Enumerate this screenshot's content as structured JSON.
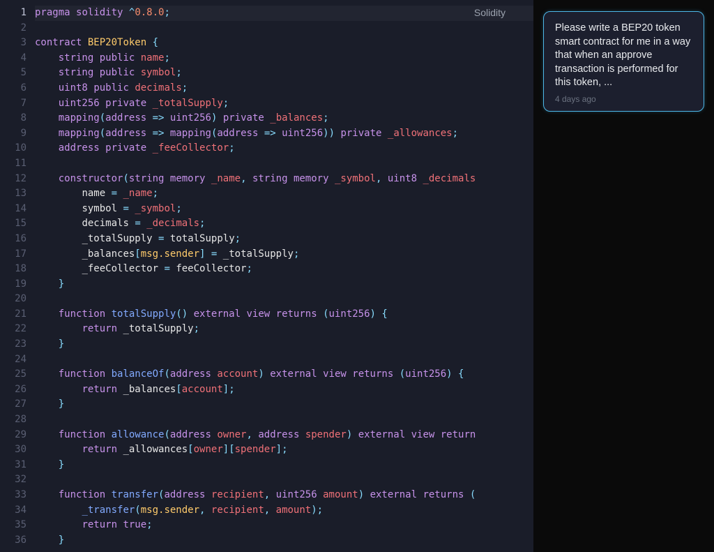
{
  "editor": {
    "language": "Solidity",
    "lineCount": 36,
    "currentLine": 1,
    "lines": [
      [
        [
          "kw",
          "pragma"
        ],
        [
          "plain",
          " "
        ],
        [
          "kw",
          "solidity"
        ],
        [
          "plain",
          " "
        ],
        [
          "op",
          "^"
        ],
        [
          "num",
          "0.8.0"
        ],
        [
          "punc",
          ";"
        ]
      ],
      [],
      [
        [
          "kw",
          "contract"
        ],
        [
          "plain",
          " "
        ],
        [
          "name",
          "BEP20Token"
        ],
        [
          "plain",
          " "
        ],
        [
          "punc",
          "{"
        ]
      ],
      [
        [
          "plain",
          "    "
        ],
        [
          "type",
          "string"
        ],
        [
          "plain",
          " "
        ],
        [
          "kw",
          "public"
        ],
        [
          "plain",
          " "
        ],
        [
          "param",
          "name"
        ],
        [
          "punc",
          ";"
        ]
      ],
      [
        [
          "plain",
          "    "
        ],
        [
          "type",
          "string"
        ],
        [
          "plain",
          " "
        ],
        [
          "kw",
          "public"
        ],
        [
          "plain",
          " "
        ],
        [
          "param",
          "symbol"
        ],
        [
          "punc",
          ";"
        ]
      ],
      [
        [
          "plain",
          "    "
        ],
        [
          "type",
          "uint8"
        ],
        [
          "plain",
          " "
        ],
        [
          "kw",
          "public"
        ],
        [
          "plain",
          " "
        ],
        [
          "param",
          "decimals"
        ],
        [
          "punc",
          ";"
        ]
      ],
      [
        [
          "plain",
          "    "
        ],
        [
          "type",
          "uint256"
        ],
        [
          "plain",
          " "
        ],
        [
          "kw",
          "private"
        ],
        [
          "plain",
          " "
        ],
        [
          "param",
          "_totalSupply"
        ],
        [
          "punc",
          ";"
        ]
      ],
      [
        [
          "plain",
          "    "
        ],
        [
          "kw",
          "mapping"
        ],
        [
          "punc",
          "("
        ],
        [
          "type",
          "address"
        ],
        [
          "plain",
          " "
        ],
        [
          "op",
          "=>"
        ],
        [
          "plain",
          " "
        ],
        [
          "type",
          "uint256"
        ],
        [
          "punc",
          ")"
        ],
        [
          "plain",
          " "
        ],
        [
          "kw",
          "private"
        ],
        [
          "plain",
          " "
        ],
        [
          "param",
          "_balances"
        ],
        [
          "punc",
          ";"
        ]
      ],
      [
        [
          "plain",
          "    "
        ],
        [
          "kw",
          "mapping"
        ],
        [
          "punc",
          "("
        ],
        [
          "type",
          "address"
        ],
        [
          "plain",
          " "
        ],
        [
          "op",
          "=>"
        ],
        [
          "plain",
          " "
        ],
        [
          "kw",
          "mapping"
        ],
        [
          "punc",
          "("
        ],
        [
          "type",
          "address"
        ],
        [
          "plain",
          " "
        ],
        [
          "op",
          "=>"
        ],
        [
          "plain",
          " "
        ],
        [
          "type",
          "uint256"
        ],
        [
          "punc",
          "))"
        ],
        [
          "plain",
          " "
        ],
        [
          "kw",
          "private"
        ],
        [
          "plain",
          " "
        ],
        [
          "param",
          "_allowances"
        ],
        [
          "punc",
          ";"
        ]
      ],
      [
        [
          "plain",
          "    "
        ],
        [
          "type",
          "address"
        ],
        [
          "plain",
          " "
        ],
        [
          "kw",
          "private"
        ],
        [
          "plain",
          " "
        ],
        [
          "param",
          "_feeCollector"
        ],
        [
          "punc",
          ";"
        ]
      ],
      [],
      [
        [
          "plain",
          "    "
        ],
        [
          "kw",
          "constructor"
        ],
        [
          "punc",
          "("
        ],
        [
          "type",
          "string"
        ],
        [
          "plain",
          " "
        ],
        [
          "kw",
          "memory"
        ],
        [
          "plain",
          " "
        ],
        [
          "param",
          "_name"
        ],
        [
          "punc",
          ","
        ],
        [
          "plain",
          " "
        ],
        [
          "type",
          "string"
        ],
        [
          "plain",
          " "
        ],
        [
          "kw",
          "memory"
        ],
        [
          "plain",
          " "
        ],
        [
          "param",
          "_symbol"
        ],
        [
          "punc",
          ","
        ],
        [
          "plain",
          " "
        ],
        [
          "type",
          "uint8"
        ],
        [
          "plain",
          " "
        ],
        [
          "param",
          "_decimals"
        ]
      ],
      [
        [
          "plain",
          "        "
        ],
        [
          "ident",
          "name"
        ],
        [
          "plain",
          " "
        ],
        [
          "op",
          "="
        ],
        [
          "plain",
          " "
        ],
        [
          "param",
          "_name"
        ],
        [
          "punc",
          ";"
        ]
      ],
      [
        [
          "plain",
          "        "
        ],
        [
          "ident",
          "symbol"
        ],
        [
          "plain",
          " "
        ],
        [
          "op",
          "="
        ],
        [
          "plain",
          " "
        ],
        [
          "param",
          "_symbol"
        ],
        [
          "punc",
          ";"
        ]
      ],
      [
        [
          "plain",
          "        "
        ],
        [
          "ident",
          "decimals"
        ],
        [
          "plain",
          " "
        ],
        [
          "op",
          "="
        ],
        [
          "plain",
          " "
        ],
        [
          "param",
          "_decimals"
        ],
        [
          "punc",
          ";"
        ]
      ],
      [
        [
          "plain",
          "        "
        ],
        [
          "ident",
          "_totalSupply"
        ],
        [
          "plain",
          " "
        ],
        [
          "op",
          "="
        ],
        [
          "plain",
          " "
        ],
        [
          "ident",
          "totalSupply"
        ],
        [
          "punc",
          ";"
        ]
      ],
      [
        [
          "plain",
          "        "
        ],
        [
          "ident",
          "_balances"
        ],
        [
          "punc",
          "["
        ],
        [
          "prop",
          "msg.sender"
        ],
        [
          "punc",
          "]"
        ],
        [
          "plain",
          " "
        ],
        [
          "op",
          "="
        ],
        [
          "plain",
          " "
        ],
        [
          "ident",
          "_totalSupply"
        ],
        [
          "punc",
          ";"
        ]
      ],
      [
        [
          "plain",
          "        "
        ],
        [
          "ident",
          "_feeCollector"
        ],
        [
          "plain",
          " "
        ],
        [
          "op",
          "="
        ],
        [
          "plain",
          " "
        ],
        [
          "ident",
          "feeCollector"
        ],
        [
          "punc",
          ";"
        ]
      ],
      [
        [
          "plain",
          "    "
        ],
        [
          "punc",
          "}"
        ]
      ],
      [],
      [
        [
          "plain",
          "    "
        ],
        [
          "kw",
          "function"
        ],
        [
          "plain",
          " "
        ],
        [
          "fn",
          "totalSupply"
        ],
        [
          "punc",
          "()"
        ],
        [
          "plain",
          " "
        ],
        [
          "kw",
          "external"
        ],
        [
          "plain",
          " "
        ],
        [
          "kw",
          "view"
        ],
        [
          "plain",
          " "
        ],
        [
          "kw",
          "returns"
        ],
        [
          "plain",
          " "
        ],
        [
          "punc",
          "("
        ],
        [
          "type",
          "uint256"
        ],
        [
          "punc",
          ")"
        ],
        [
          "plain",
          " "
        ],
        [
          "punc",
          "{"
        ]
      ],
      [
        [
          "plain",
          "        "
        ],
        [
          "kw",
          "return"
        ],
        [
          "plain",
          " "
        ],
        [
          "ident",
          "_totalSupply"
        ],
        [
          "punc",
          ";"
        ]
      ],
      [
        [
          "plain",
          "    "
        ],
        [
          "punc",
          "}"
        ]
      ],
      [],
      [
        [
          "plain",
          "    "
        ],
        [
          "kw",
          "function"
        ],
        [
          "plain",
          " "
        ],
        [
          "fn",
          "balanceOf"
        ],
        [
          "punc",
          "("
        ],
        [
          "type",
          "address"
        ],
        [
          "plain",
          " "
        ],
        [
          "param",
          "account"
        ],
        [
          "punc",
          ")"
        ],
        [
          "plain",
          " "
        ],
        [
          "kw",
          "external"
        ],
        [
          "plain",
          " "
        ],
        [
          "kw",
          "view"
        ],
        [
          "plain",
          " "
        ],
        [
          "kw",
          "returns"
        ],
        [
          "plain",
          " "
        ],
        [
          "punc",
          "("
        ],
        [
          "type",
          "uint256"
        ],
        [
          "punc",
          ")"
        ],
        [
          "plain",
          " "
        ],
        [
          "punc",
          "{"
        ]
      ],
      [
        [
          "plain",
          "        "
        ],
        [
          "kw",
          "return"
        ],
        [
          "plain",
          " "
        ],
        [
          "ident",
          "_balances"
        ],
        [
          "punc",
          "["
        ],
        [
          "param",
          "account"
        ],
        [
          "punc",
          "]"
        ],
        [
          "punc",
          ";"
        ]
      ],
      [
        [
          "plain",
          "    "
        ],
        [
          "punc",
          "}"
        ]
      ],
      [],
      [
        [
          "plain",
          "    "
        ],
        [
          "kw",
          "function"
        ],
        [
          "plain",
          " "
        ],
        [
          "fn",
          "allowance"
        ],
        [
          "punc",
          "("
        ],
        [
          "type",
          "address"
        ],
        [
          "plain",
          " "
        ],
        [
          "param",
          "owner"
        ],
        [
          "punc",
          ","
        ],
        [
          "plain",
          " "
        ],
        [
          "type",
          "address"
        ],
        [
          "plain",
          " "
        ],
        [
          "param",
          "spender"
        ],
        [
          "punc",
          ")"
        ],
        [
          "plain",
          " "
        ],
        [
          "kw",
          "external"
        ],
        [
          "plain",
          " "
        ],
        [
          "kw",
          "view"
        ],
        [
          "plain",
          " "
        ],
        [
          "kw",
          "return"
        ]
      ],
      [
        [
          "plain",
          "        "
        ],
        [
          "kw",
          "return"
        ],
        [
          "plain",
          " "
        ],
        [
          "ident",
          "_allowances"
        ],
        [
          "punc",
          "["
        ],
        [
          "param",
          "owner"
        ],
        [
          "punc",
          "]["
        ],
        [
          "param",
          "spender"
        ],
        [
          "punc",
          "]"
        ],
        [
          "punc",
          ";"
        ]
      ],
      [
        [
          "plain",
          "    "
        ],
        [
          "punc",
          "}"
        ]
      ],
      [],
      [
        [
          "plain",
          "    "
        ],
        [
          "kw",
          "function"
        ],
        [
          "plain",
          " "
        ],
        [
          "fn",
          "transfer"
        ],
        [
          "punc",
          "("
        ],
        [
          "type",
          "address"
        ],
        [
          "plain",
          " "
        ],
        [
          "param",
          "recipient"
        ],
        [
          "punc",
          ","
        ],
        [
          "plain",
          " "
        ],
        [
          "type",
          "uint256"
        ],
        [
          "plain",
          " "
        ],
        [
          "param",
          "amount"
        ],
        [
          "punc",
          ")"
        ],
        [
          "plain",
          " "
        ],
        [
          "kw",
          "external"
        ],
        [
          "plain",
          " "
        ],
        [
          "kw",
          "returns"
        ],
        [
          "plain",
          " "
        ],
        [
          "punc",
          "("
        ]
      ],
      [
        [
          "plain",
          "        "
        ],
        [
          "fn",
          "_transfer"
        ],
        [
          "punc",
          "("
        ],
        [
          "prop",
          "msg.sender"
        ],
        [
          "punc",
          ","
        ],
        [
          "plain",
          " "
        ],
        [
          "param",
          "recipient"
        ],
        [
          "punc",
          ","
        ],
        [
          "plain",
          " "
        ],
        [
          "param",
          "amount"
        ],
        [
          "punc",
          ");"
        ]
      ],
      [
        [
          "plain",
          "        "
        ],
        [
          "kw",
          "return"
        ],
        [
          "plain",
          " "
        ],
        [
          "kw",
          "true"
        ],
        [
          "punc",
          ";"
        ]
      ],
      [
        [
          "plain",
          "    "
        ],
        [
          "punc",
          "}"
        ]
      ]
    ]
  },
  "sidebar": {
    "prompt": {
      "text": "Please write a BEP20 token smart contract for me in a way that when an approve transaction is performed for this token, ...",
      "time": "4 days ago"
    }
  }
}
